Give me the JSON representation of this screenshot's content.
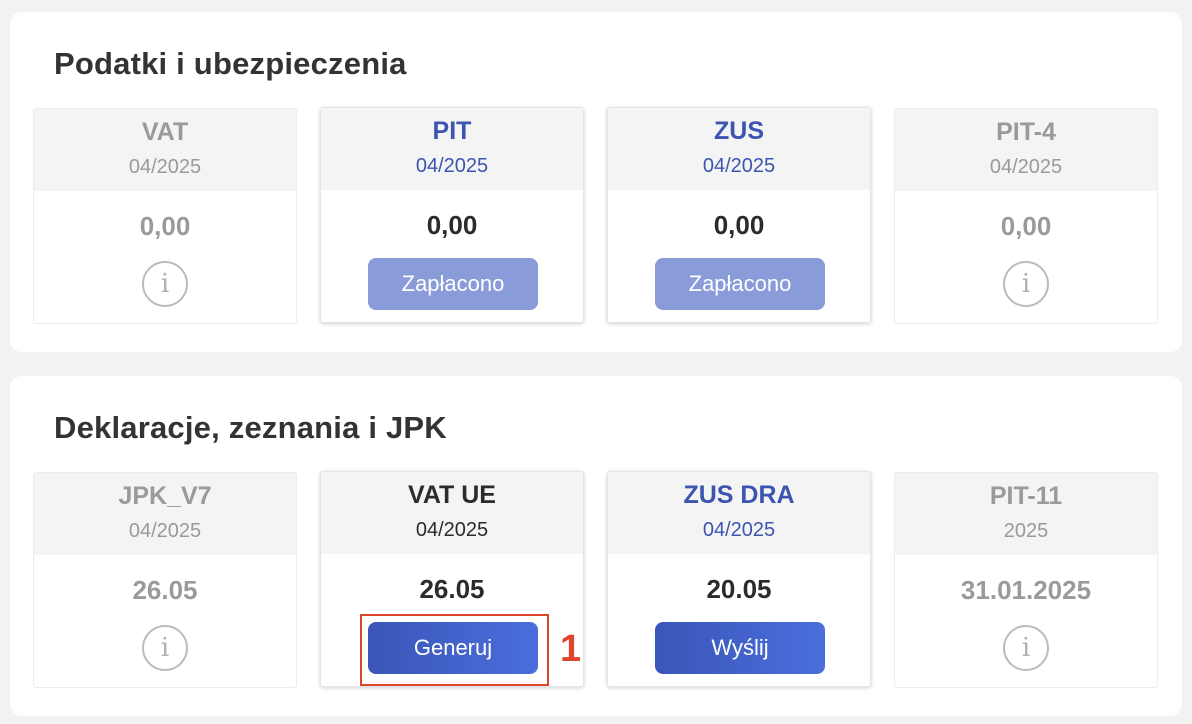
{
  "sections": [
    {
      "title": "Podatki i ubezpieczenia",
      "cards": [
        {
          "title": "VAT",
          "period": "04/2025",
          "amount": "0,00",
          "icon": "info-icon"
        },
        {
          "title": "PIT",
          "period": "04/2025",
          "amount": "0,00",
          "button": "Zapłacono"
        },
        {
          "title": "ZUS",
          "period": "04/2025",
          "amount": "0,00",
          "button": "Zapłacono"
        },
        {
          "title": "PIT-4",
          "period": "04/2025",
          "amount": "0,00",
          "icon": "info-icon"
        }
      ]
    },
    {
      "title": "Deklaracje, zeznania i JPK",
      "cards": [
        {
          "title": "JPK_V7",
          "period": "04/2025",
          "amount": "26.05",
          "icon": "info-icon"
        },
        {
          "title": "VAT UE",
          "period": "04/2025",
          "amount": "26.05",
          "button": "Generuj"
        },
        {
          "title": "ZUS DRA",
          "period": "04/2025",
          "amount": "20.05",
          "button": "Wyślij"
        },
        {
          "title": "PIT-11",
          "period": "2025",
          "amount": "31.01.2025",
          "icon": "info-icon"
        }
      ]
    }
  ],
  "annotation": {
    "marker": "1",
    "color": "#e0452b"
  },
  "colors": {
    "accent": "#3b55b0",
    "button_paid": "#8a9bda",
    "button_action": "#4260c8",
    "muted_text": "#9a9a9a"
  },
  "info_glyph": "i"
}
